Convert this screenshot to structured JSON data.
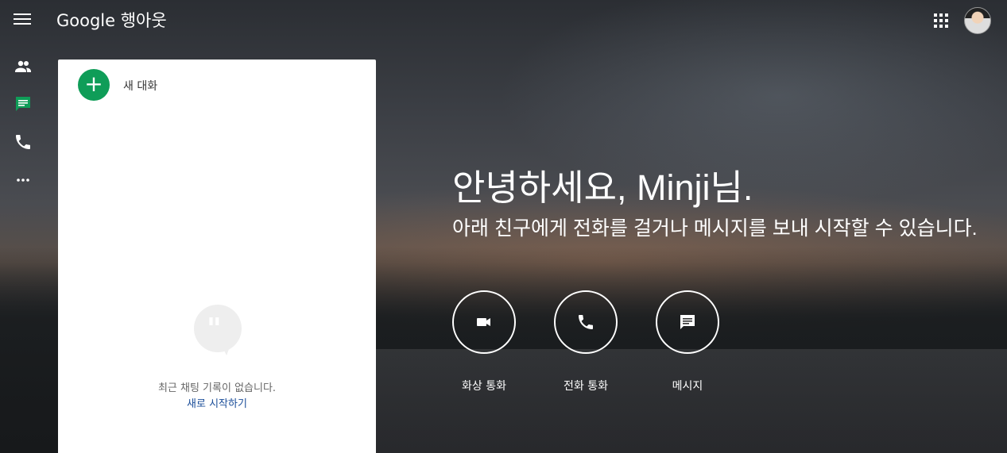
{
  "header": {
    "brand": "Google 행아웃"
  },
  "panel": {
    "new_chat_label": "새 대화",
    "empty_text": "최근 채팅 기록이 없습니다.",
    "start_link": "새로 시작하기"
  },
  "main": {
    "greeting": "안녕하세요, Minji님.",
    "subtitle": "아래 친구에게 전화를 걸거나 메시지를 보내 시작할 수 있습니다.",
    "actions": [
      {
        "label": "화상 통화",
        "icon": "video-icon"
      },
      {
        "label": "전화 통화",
        "icon": "phone-icon"
      },
      {
        "label": "메시지",
        "icon": "message-icon"
      }
    ]
  },
  "colors": {
    "accent": "#0f9d58",
    "link": "#1a4d99"
  }
}
